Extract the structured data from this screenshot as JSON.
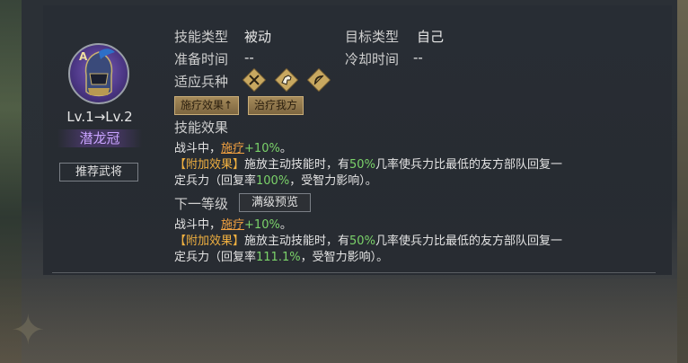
{
  "hero": {
    "grade": "A",
    "level_text": "Lv.1→Lv.2",
    "skill_name": "潜龙冠",
    "recommend_label": "推荐武将"
  },
  "info": {
    "skill_type_label": "技能类型",
    "skill_type_value": "被动",
    "target_type_label": "目标类型",
    "target_type_value": "自己",
    "prep_time_label": "准备时间",
    "prep_time_value": "--",
    "cooldown_label": "冷却时间",
    "cooldown_value": "--",
    "troop_label": "适应兵种",
    "troops": [
      "infantry-icon",
      "cavalry-icon",
      "archer-icon"
    ]
  },
  "tags": [
    "施疗效果↑",
    "治疗我方"
  ],
  "effect": {
    "title": "技能效果",
    "line1_prefix": "战斗中，",
    "line1_link": "施疗",
    "line1_value": "+10%",
    "line1_suffix": "。",
    "extra_tag": "【附加效果】",
    "extra_text_a": "施放主动技能时，有",
    "extra_pct": "50%",
    "extra_text_b": "几率使兵力比最低的友方部队回复一",
    "extra_text_c": "定兵力（回复率",
    "extra_rate": "100%",
    "extra_text_d": "，受智力影响）。"
  },
  "next_level": {
    "title": "下一等级",
    "preview_button": "满级预览",
    "line1_prefix": "战斗中，",
    "line1_link": "施疗",
    "line1_value": "+10%",
    "line1_suffix": "。",
    "extra_tag": "【附加效果】",
    "extra_text_a": "施放主动技能时，有",
    "extra_pct": "50%",
    "extra_text_b": "几率使兵力比最低的友方部队回复一",
    "extra_text_c": "定兵力（回复率",
    "extra_rate": "111.1%",
    "extra_text_d": "，受智力影响）。"
  },
  "colors": {
    "accent_gold": "#f0b040",
    "value_green": "#7bd36a",
    "skill_name_purple": "#c9a3ff"
  }
}
